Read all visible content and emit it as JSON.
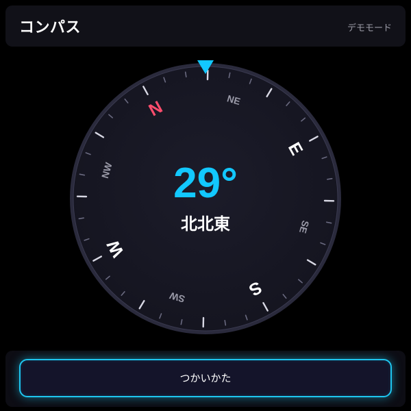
{
  "header": {
    "title": "コンパス",
    "mode": "デモモード"
  },
  "compass": {
    "heading_value": "29°",
    "heading_degrees": 29,
    "heading_direction": "北北東",
    "cardinals": [
      {
        "label": "N",
        "bearing": 0,
        "color": "#ff4d6d"
      },
      {
        "label": "E",
        "bearing": 90,
        "color": "#ffffff"
      },
      {
        "label": "S",
        "bearing": 180,
        "color": "#ffffff"
      },
      {
        "label": "W",
        "bearing": 270,
        "color": "#ffffff"
      }
    ],
    "intercardinals": [
      {
        "label": "NE",
        "bearing": 45
      },
      {
        "label": "SE",
        "bearing": 135
      },
      {
        "label": "SW",
        "bearing": 225
      },
      {
        "label": "NW",
        "bearing": 315
      }
    ],
    "accent_color": "#12c8ff",
    "pointer_icon": "triangle-down-icon"
  },
  "footer": {
    "help_label": "つかいかた"
  }
}
